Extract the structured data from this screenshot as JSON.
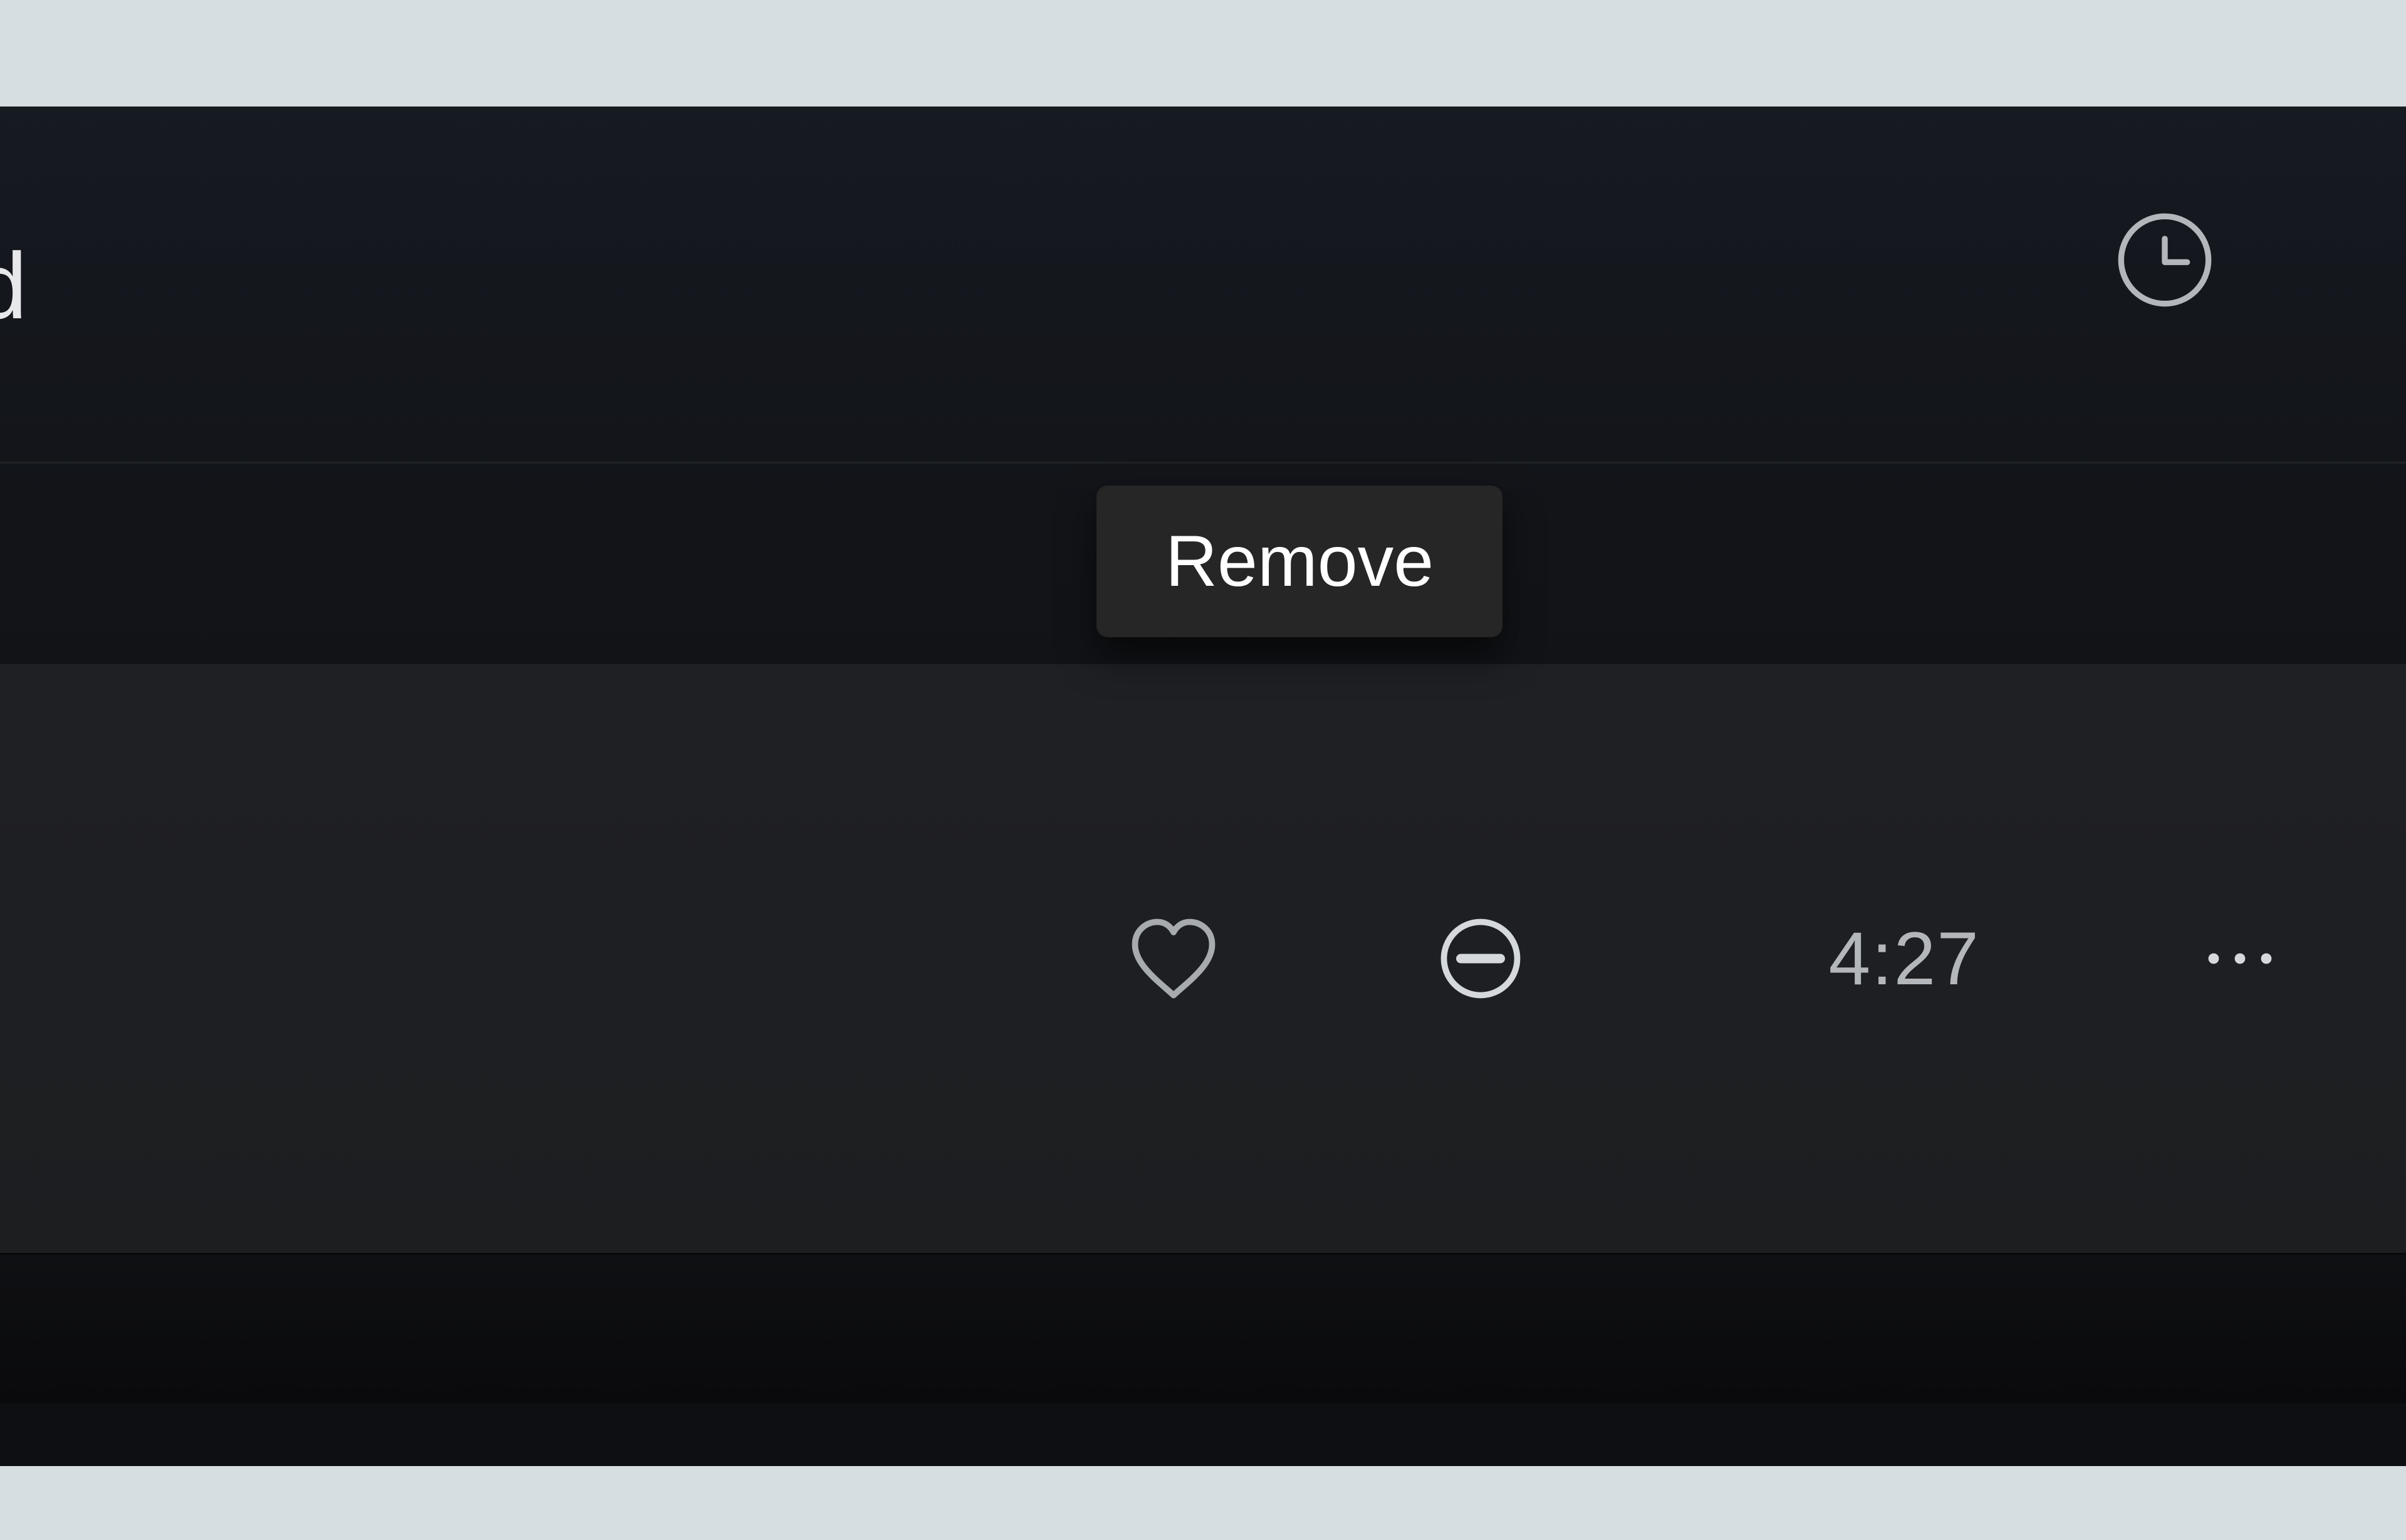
{
  "header": {
    "visible_text_fragment": "d"
  },
  "tooltip": {
    "label": "Remove"
  },
  "track": {
    "duration": "4:27"
  }
}
